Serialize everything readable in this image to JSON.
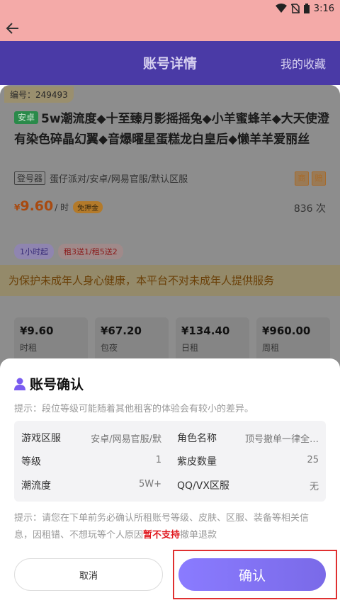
{
  "status": {
    "time": "3:16"
  },
  "header": {
    "title": "账号详情",
    "favorites": "我的收藏"
  },
  "listing": {
    "id_label": "编号：249493",
    "platform_badge": "安卓",
    "title": "5w潮流度◆十至臻月影摇摇兔◆小羊蜜蜂羊◆大天使澄有染色碎晶幻翼◆音爆曜星蛋糕龙白皇后◆懒羊羊爱丽丝",
    "login_badge": "登号器",
    "server_path": "蛋仔派对/安卓/网易官服/默认区服",
    "tag_shang": "商",
    "tag_pei": "赔",
    "price_symbol": "¥",
    "price": "9.60",
    "price_unit": "/ 时",
    "promo": "免押金",
    "rent_count": "836 次",
    "pills": [
      "1小时起",
      "租3送1/租5送2"
    ],
    "notice": "为保护未成年人身心健康，本平台不对未成年人提供服务",
    "plans": [
      {
        "price": "¥9.60",
        "name": "时租"
      },
      {
        "price": "¥67.20",
        "name": "包夜"
      },
      {
        "price": "¥134.40",
        "name": "日租"
      },
      {
        "price": "¥960.00",
        "name": "周租"
      }
    ]
  },
  "dialog": {
    "title": "账号确认",
    "hint": "提示：段位等级可能随着其他租客的体验会有较小的差异。",
    "fields": {
      "server_label": "游戏区服",
      "server_value": "安卓/网易官服/默",
      "role_label": "角色名称",
      "role_value": "顶号撤单一律全…",
      "level_label": "等级",
      "level_value": "1",
      "skins_label": "紫皮数量",
      "skins_value": "25",
      "trend_label": "潮流度",
      "trend_value": "5W+",
      "qq_label": "QQ/VX区服",
      "qq_value": "无"
    },
    "warning_part1": "提示：请您在下单前务必确认所租账号等级、皮肤、区服、装备等相关信息，因租错、不想玩等个人原因",
    "warning_highlight": "暂不支持",
    "warning_part2": "撤单退款",
    "cancel_label": "取消",
    "confirm_label": "确认"
  }
}
